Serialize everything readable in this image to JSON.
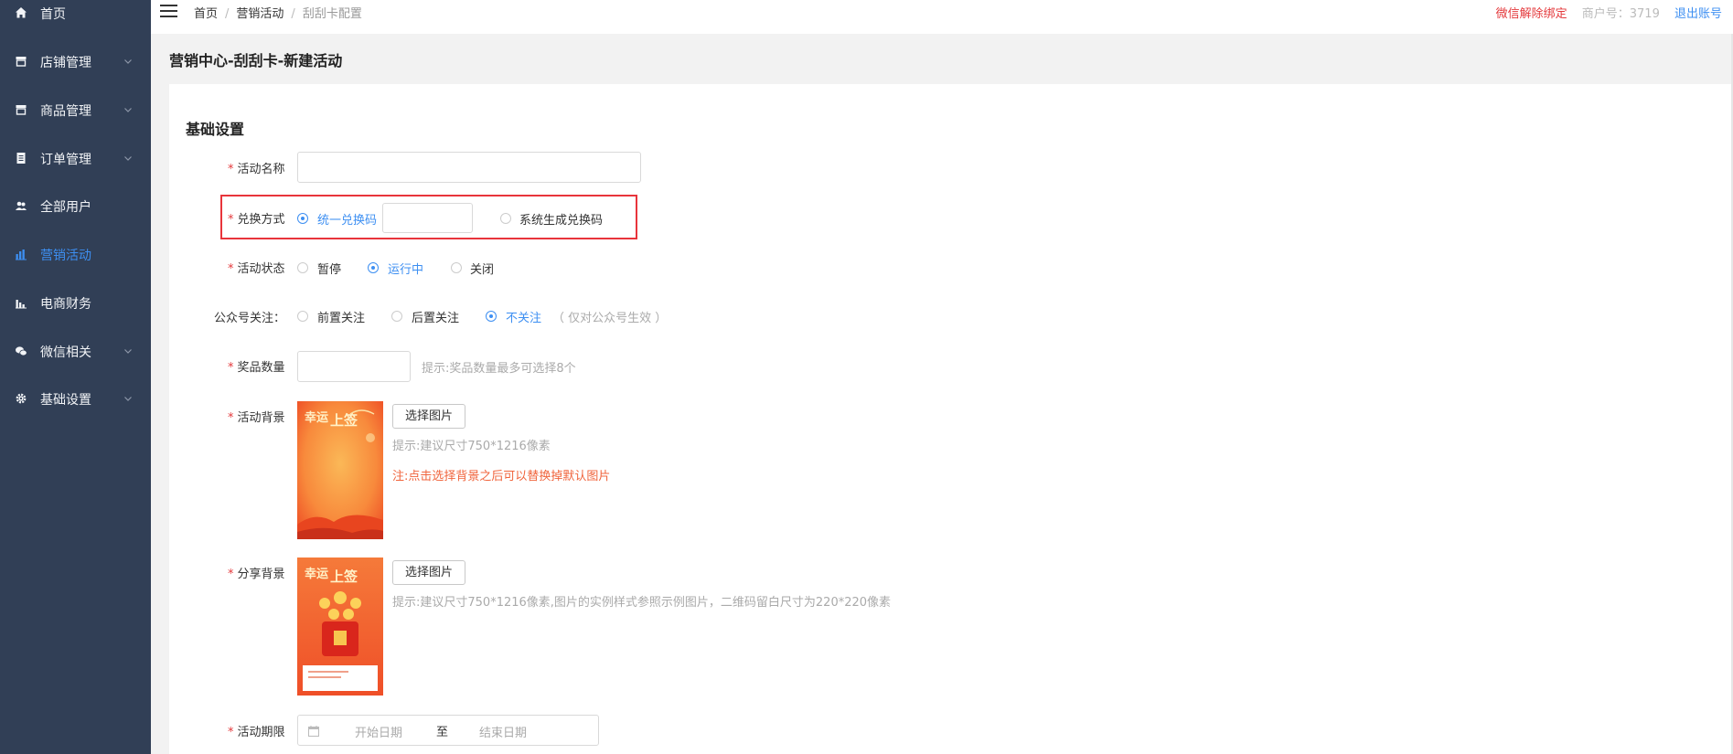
{
  "sidebar": {
    "items": [
      {
        "label": "首页",
        "icon": "home-icon"
      },
      {
        "label": "店铺管理",
        "icon": "store-icon"
      },
      {
        "label": "商品管理",
        "icon": "store-icon"
      },
      {
        "label": "订单管理",
        "icon": "document-icon"
      },
      {
        "label": "全部用户",
        "icon": "users-icon"
      },
      {
        "label": "营销活动",
        "icon": "bar-chart-icon",
        "active": true
      },
      {
        "label": "电商财务",
        "icon": "bar-chart-icon"
      },
      {
        "label": "微信相关",
        "icon": "wechat-icon"
      },
      {
        "label": "基础设置",
        "icon": "gear-icon"
      }
    ]
  },
  "header": {
    "breadcrumb": [
      "首页",
      "营销活动",
      "刮刮卡配置"
    ],
    "unbind_wechat": "微信解除绑定",
    "merchant_no": "商户号：3719",
    "logout": "退出账号"
  },
  "page": {
    "heading": "营销中心-刮刮卡-新建活动"
  },
  "form": {
    "section_title": "基础设置",
    "required_mark": "*",
    "activity_name": {
      "label": "活动名称",
      "value": ""
    },
    "exchange_method": {
      "label": "兑换方式",
      "options": [
        "统一兑换码",
        "系统生成兑换码"
      ],
      "selected": 0,
      "code_value": ""
    },
    "activity_status": {
      "label": "活动状态",
      "options": [
        "暂停",
        "运行中",
        "关闭"
      ],
      "selected": 1
    },
    "follow_account": {
      "label": "公众号关注：",
      "options": [
        "前置关注",
        "后置关注",
        "不关注"
      ],
      "selected": 2,
      "note": "（ 仅对公众号生效 ）"
    },
    "prize_count": {
      "label": "奖品数量",
      "value": "",
      "hint": "提示:奖品数量最多可选择8个"
    },
    "activity_background": {
      "label": "活动背景",
      "button": "选择图片",
      "hint": "提示:建议尺寸750*1216像素",
      "warning": "注:点击选择背景之后可以替换掉默认图片"
    },
    "share_background": {
      "label": "分享背景",
      "button": "选择图片",
      "hint": "提示:建议尺寸750*1216像素,图片的实例样式参照示例图片，二维码留白尺寸为220*220像素"
    },
    "activity_period": {
      "label": "活动期限",
      "start_placeholder": "开始日期",
      "separator": "至",
      "end_placeholder": "结束日期"
    }
  },
  "colors": {
    "sidebar_bg": "#313f56",
    "accent": "#3d8ff2",
    "required": "#e4393c",
    "highlight_border": "#e8343b",
    "warning": "#f0643c"
  }
}
